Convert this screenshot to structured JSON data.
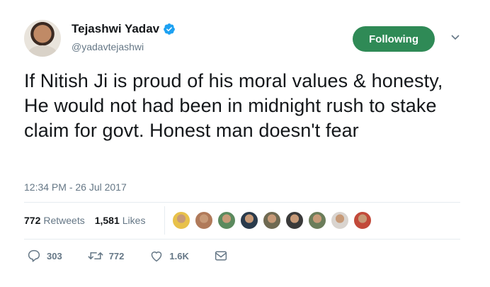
{
  "author": {
    "name": "Tejashwi Yadav",
    "handle": "@yadavtejashwi",
    "verified_icon": "verified-badge-icon"
  },
  "follow_button": {
    "label": "Following",
    "color": "#2f8a56"
  },
  "tweet": {
    "text": "If Nitish Ji is proud of his moral values & honesty, He would not had been in midnight rush to stake claim for govt. Honest man doesn't fear",
    "timestamp": "12:34 PM - 26 Jul 2017"
  },
  "stats": {
    "retweets_count": "772",
    "retweets_label": "Retweets",
    "likes_count": "1,581",
    "likes_label": "Likes"
  },
  "likers": [
    "#e8c14a",
    "#b07a5a",
    "#5b8a5e",
    "#2a3b4c",
    "#6f6a52",
    "#3a3a3a",
    "#6b7d5a",
    "#d9d4cf",
    "#c24a3a"
  ],
  "actions": {
    "reply": {
      "icon": "reply-icon",
      "count": "303"
    },
    "retweet": {
      "icon": "retweet-icon",
      "count": "772"
    },
    "like": {
      "icon": "heart-icon",
      "count": "1.6K"
    },
    "message": {
      "icon": "direct-message-icon"
    }
  },
  "colors": {
    "accent_blue": "#1da1f2",
    "text_gray": "#657786"
  }
}
